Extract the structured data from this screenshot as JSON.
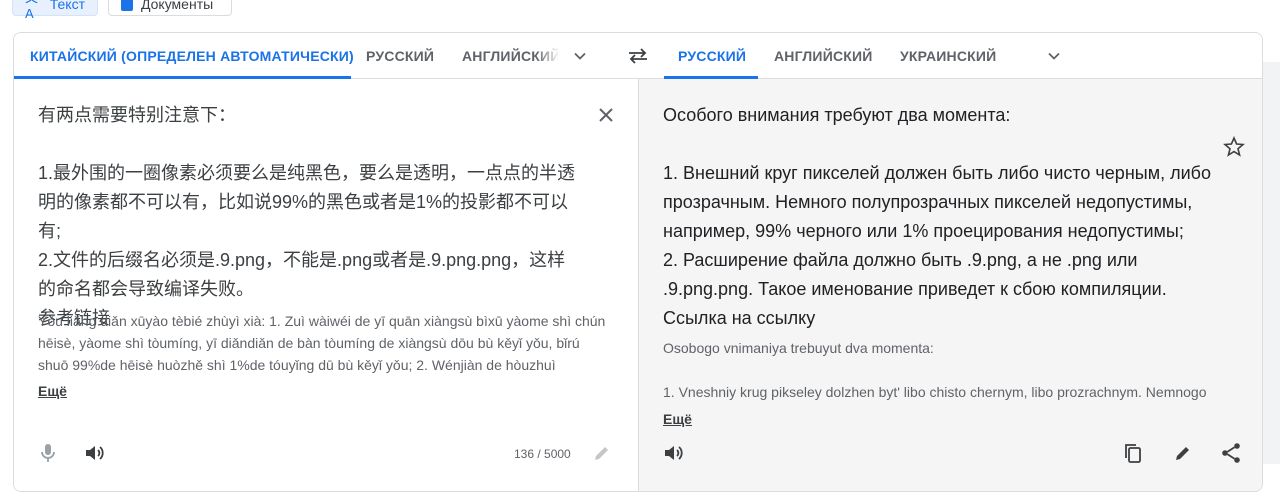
{
  "top": {
    "mode_text": "Текст",
    "mode_docs": "Документы"
  },
  "source_tabs": [
    {
      "label": "КИТАЙСКИЙ (ОПРЕДЕЛЕН АВТОМАТИЧЕСКИ)",
      "active": true
    },
    {
      "label": "РУССКИЙ",
      "active": false
    },
    {
      "label": "АНГЛИЙСКИЙ",
      "active": false
    }
  ],
  "target_tabs": [
    {
      "label": "РУССКИЙ",
      "active": true
    },
    {
      "label": "АНГЛИЙСКИЙ",
      "active": false
    },
    {
      "label": "УКРАИНСКИЙ",
      "active": false
    }
  ],
  "source": {
    "text": "有两点需要特别注意下：\n\n1.最外围的一圈像素必须要么是纯黑色，要么是透明，一点点的半透明的像素都不可以有，比如说99%的黑色或者是1%的投影都不可以有;\n2.文件的后缀名必须是.9.png，不能是.png或者是.9.png.png，这样的命名都会导致编译失败。\n参考链接",
    "transliteration": "Yǒu liǎng diǎn xūyào tèbié zhùyì xià: 1. Zuì wàiwéi de yī quān xiàngsù bìxū yàome shì chún hēisè, yàome shì tòumíng, yī diǎndiǎn de bàn tòumíng de xiàngsù dōu bù kěyǐ yǒu, bǐrú shuō 99%de hēisè huòzhě shì 1%de tóuyǐng dū bù kěyǐ yǒu; 2. Wénjiàn de hòuzhuì",
    "more": "Ещё",
    "counter": "136 / 5000"
  },
  "target": {
    "text": "Особого внимания требуют два момента:\n\n1. Внешний круг пикселей должен быть либо чисто черным, либо прозрачным. Немного полупрозрачных пикселей недопустимы, например, 99% черного или 1% проецирования недопустимы;\n2. Расширение файла должно быть .9.png, а не .png или .9.png.png. Такое именование приведет к сбою компиляции.\nСсылка на ссылку",
    "transliteration": "Osobogo vnimaniya trebuyut dva momenta:\n\n1. Vneshniy krug pikseley dolzhen byt' libo chisto chernym, libo prozrachnym. Nemnogo",
    "more": "Ещё"
  },
  "colors": {
    "accent": "#1a73e8",
    "text": "#202124",
    "muted": "#5f6368",
    "pane_right_bg": "#f5f5f5",
    "border": "#dadce0"
  }
}
